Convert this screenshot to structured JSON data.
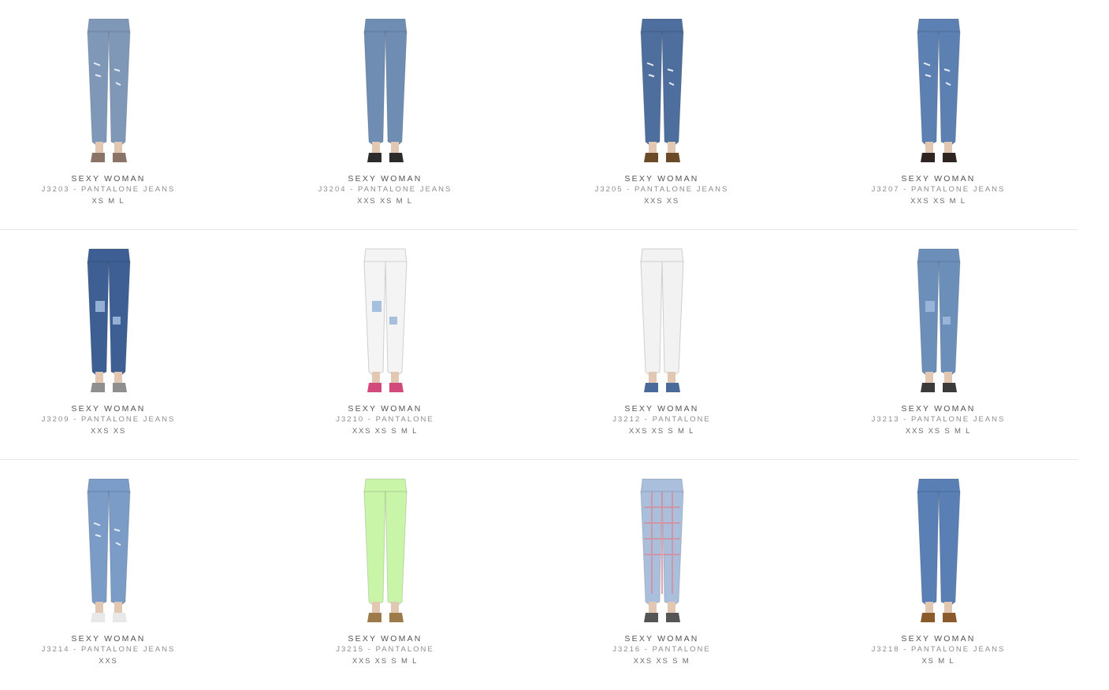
{
  "products": [
    {
      "brand": "SEXY WOMAN",
      "name": "J3203 - PANTALONE JEANS",
      "sizes": "XS M L",
      "jean_color": "#7f98b8",
      "shoe_color": "#8a7468",
      "icon": "light-wash-skinny-jeans"
    },
    {
      "brand": "SEXY WOMAN",
      "name": "J3204 - PANTALONE JEANS",
      "sizes": "XXS XS M L",
      "jean_color": "#6f8db3",
      "shoe_color": "#2b2b2b",
      "icon": "cropped-jeans"
    },
    {
      "brand": "SEXY WOMAN",
      "name": "J3205 - PANTALONE JEANS",
      "sizes": "XXS XS",
      "jean_color": "#4e6f9d",
      "shoe_color": "#6b4a2a",
      "icon": "ripped-jeans"
    },
    {
      "brand": "SEXY WOMAN",
      "name": "J3207 - PANTALONE JEANS",
      "sizes": "XXS XS M L",
      "jean_color": "#5d80b3",
      "shoe_color": "#2e2522",
      "icon": "ripped-skinny-jeans"
    },
    {
      "brand": "SEXY WOMAN",
      "name": "J3209 - PANTALONE JEANS",
      "sizes": "XXS XS",
      "jean_color": "#3d5f93",
      "shoe_color": "#8f8f8f",
      "icon": "patched-dark-jeans"
    },
    {
      "brand": "SEXY WOMAN",
      "name": "J3210 - PANTALONE",
      "sizes": "XXS XS S M L",
      "jean_color": "#f4f4f4",
      "shoe_color": "#d24a7c",
      "icon": "white-patched-pants"
    },
    {
      "brand": "SEXY WOMAN",
      "name": "J3212 - PANTALONE",
      "sizes": "XXS XS S M L",
      "jean_color": "#f2f2f2",
      "shoe_color": "#4a6a9a",
      "icon": "white-pants"
    },
    {
      "brand": "SEXY WOMAN",
      "name": "J3213 - PANTALONE JEANS",
      "sizes": "XXS XS S M L",
      "jean_color": "#6c8fba",
      "shoe_color": "#3a3a3a",
      "icon": "suspender-jeans"
    },
    {
      "brand": "SEXY WOMAN",
      "name": "J3214 - PANTALONE JEANS",
      "sizes": "XXS",
      "jean_color": "#7a9cc6",
      "shoe_color": "#e8e8e8",
      "icon": "distressed-jeans"
    },
    {
      "brand": "SEXY WOMAN",
      "name": "J3215 - PANTALONE",
      "sizes": "XXS XS S M L",
      "jean_color": "#c9f5a8",
      "shoe_color": "#9c7a4a",
      "icon": "neon-green-pants"
    },
    {
      "brand": "SEXY WOMAN",
      "name": "J3216 - PANTALONE",
      "sizes": "XXS XS S M",
      "jean_color": "#a9bfdc",
      "shoe_color": "#555555",
      "icon": "plaid-pants"
    },
    {
      "brand": "SEXY WOMAN",
      "name": "J3218 - PANTALONE JEANS",
      "sizes": "XS M L",
      "jean_color": "#5a7fb5",
      "shoe_color": "#8a5a2a",
      "icon": "classic-skinny-jeans"
    }
  ]
}
